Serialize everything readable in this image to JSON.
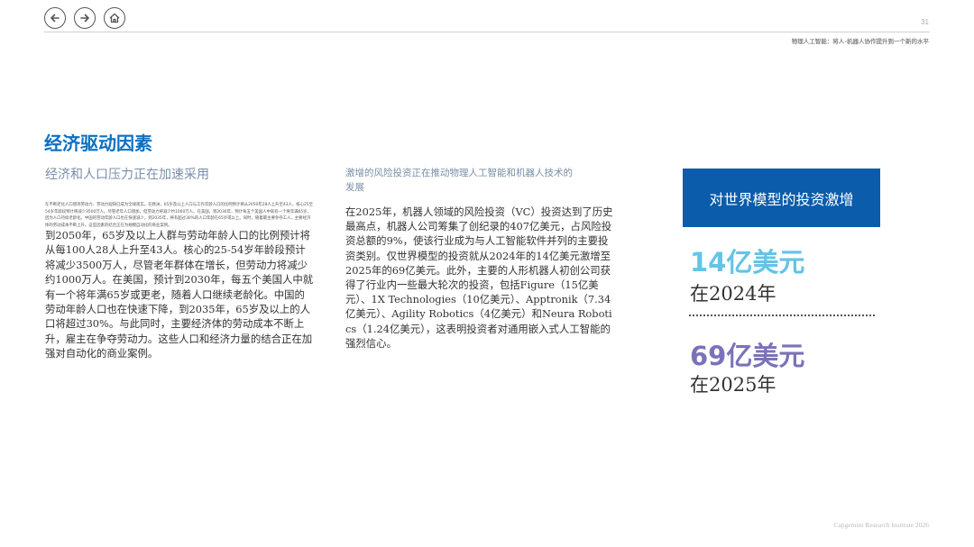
{
  "nav": {
    "back_icon": "arrow-left-icon",
    "forward_icon": "arrow-right-icon",
    "home_icon": "home-icon"
  },
  "header": {
    "page_number": "31",
    "title": "物理人工智能：将人-机器人协作提升到一个新的水平"
  },
  "section": {
    "title": "经济驱动因素"
  },
  "left_column": {
    "subtitle": "经济和人口压力正在加速采用",
    "small_text": "在不断老化人口增添劳动力、劳动力短缺已成为全球现实。在欧洲，65岁及以上人口与工作年龄人口的比例预计将从2050年28人上升至43人，核心25至54岁年龄段预计将减少3500万人。尽管老年人口增加，但劳动力将减少约1000万人。在美国，到2030年，预计每五个美国人中就有一个将年满65岁，因为人口持续老龄化。中国的劳动年龄人口也在快速减少，到2035年，将有超过30%的人口年龄在65岁或以上。同时，随着最主要争夺工人，主要经济体的劳动成本不断上升。这些因素的结合正在为规模自动化的商业案例。",
    "body": "到2050年，65岁及以上人群与劳动年龄人口的比例预计将从每100人28人上升至43人。核心的25-54岁年龄段预计将减少3500万人，尽管老年群体在增长，但劳动力将减少约1000万人。在美国，预计到2030年，每五个美国人中就有一个将年满65岁或更老，随着人口继续老龄化。中国的劳动年龄人口也在快速下降，到2035年，65岁及以上的人口将超过30%。与此同时，主要经济体的劳动成本不断上升，雇主在争夺劳动力。这些人口和经济力量的结合正在加强对自动化的商业案例。"
  },
  "middle_column": {
    "subtitle": "激增的风险投资正在推动物理人工智能和机器人技术的发展",
    "body": "在2025年，机器人领域的风险投资（VC）投资达到了历史最高点，机器人公司筹集了创纪录的407亿美元，占风险投资总额的9%，使该行业成为与人工智能软件并列的主要投资类别。仅世界模型的投资就从2024年的14亿美元激增至2025年的69亿美元。此外，主要的人形机器人初创公司获得了行业内一些最大轮次的投资，包括Figure（15亿美元）、1X Technologies（10亿美元）、Apptronik（7.34亿美元）、Agility Robotics（4亿美元）和Neura Robotics（1.24亿美元），这表明投资者对通用嵌入式人工智能的强烈信心。"
  },
  "stats": {
    "box_title": "对世界模型的投资激增",
    "stat1_value": "14亿美元",
    "stat1_label": "在2024年",
    "stat2_value": "69亿美元",
    "stat2_label": "在2025年",
    "box_color": "#0b5cab",
    "stat1_color": "#63c4e6",
    "stat2_color": "#7b73b8"
  },
  "footer": {
    "text": "Capgemini Research Institute 2026"
  }
}
